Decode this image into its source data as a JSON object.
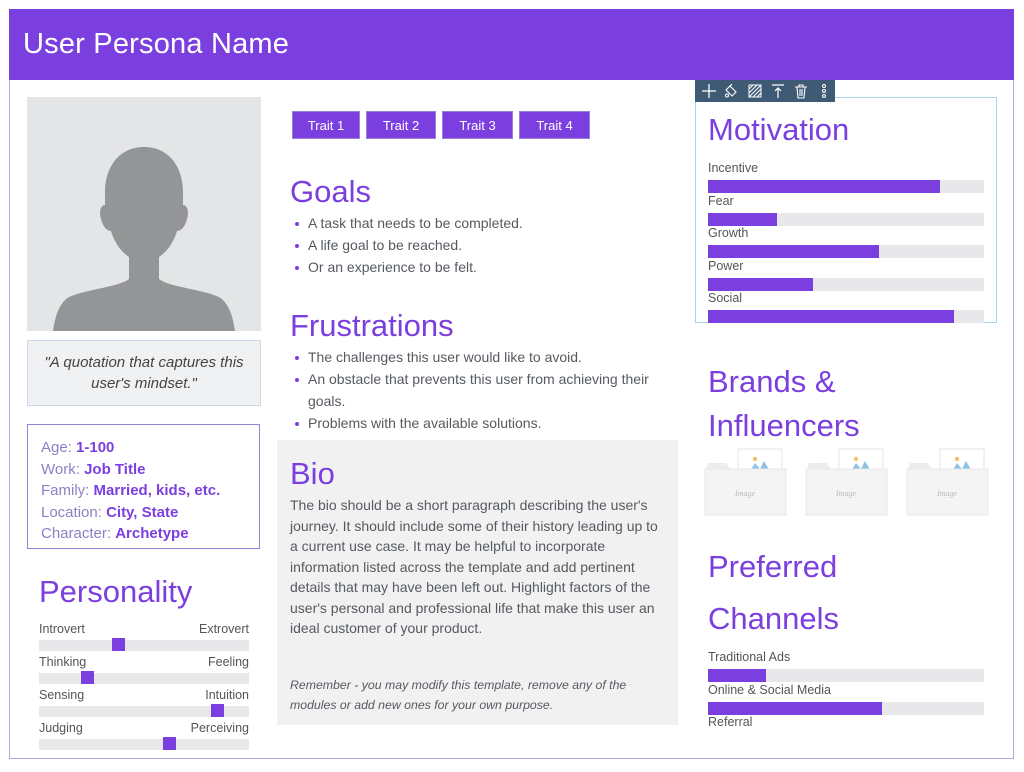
{
  "header": {
    "title": "User Persona Name"
  },
  "colors": {
    "accent": "#7b3fe0",
    "track": "#e8e8ea",
    "panel": "#f1f1f2",
    "toolbar": "#3e5a75"
  },
  "avatar": {
    "icon": "person-silhouette-icon"
  },
  "quote": "\"A quotation that captures this user's mindset.\"",
  "info": [
    {
      "label": "Age:",
      "value": "1-100"
    },
    {
      "label": "Work:",
      "value": "Job Title"
    },
    {
      "label": "Family:",
      "value": "Married, kids, etc."
    },
    {
      "label": "Location:",
      "value": "City, State"
    },
    {
      "label": "Character:",
      "value": "Archetype"
    }
  ],
  "personality": {
    "title": "Personality",
    "sliders": [
      {
        "left": "Introvert",
        "right": "Extrovert",
        "percent": 38
      },
      {
        "left": "Thinking",
        "right": "Feeling",
        "percent": 23
      },
      {
        "left": "Sensing",
        "right": "Intuition",
        "percent": 85
      },
      {
        "left": "Judging",
        "right": "Perceiving",
        "percent": 62
      }
    ]
  },
  "traits": [
    "Trait 1",
    "Trait 2",
    "Trait 3",
    "Trait 4"
  ],
  "goals": {
    "title": "Goals",
    "items": [
      "A task that needs to be completed.",
      "A life goal to be reached.",
      "Or an experience to be felt."
    ]
  },
  "frustrations": {
    "title": "Frustrations",
    "items": [
      "The challenges this user would like to avoid.",
      "An obstacle that prevents this user from achieving their goals.",
      "Problems with the available solutions."
    ]
  },
  "bio": {
    "title": "Bio",
    "body": "The bio should be a short paragraph describing the user's journey. It should include some of their history leading up to a current use case. It may be helpful to incorporate information listed across the template and add pertinent details that may have been left out. Highlight factors of the user's personal and professional life that make this user an ideal customer of your product.",
    "note": "Remember - you may modify this template, remove any of the modules or add new ones for your own purpose."
  },
  "toolbar": {
    "buttons": [
      {
        "name": "add-icon"
      },
      {
        "name": "paint-bucket-icon"
      },
      {
        "name": "pattern-fill-icon"
      },
      {
        "name": "move-to-top-icon"
      },
      {
        "name": "trash-icon"
      },
      {
        "name": "more-vertical-icon"
      }
    ]
  },
  "motivation": {
    "title": "Motivation",
    "bars": [
      {
        "label": "Incentive",
        "percent": 84
      },
      {
        "label": "Fear",
        "percent": 25
      },
      {
        "label": "Growth",
        "percent": 62
      },
      {
        "label": "Power",
        "percent": 38
      },
      {
        "label": "Social",
        "percent": 89
      }
    ]
  },
  "brands": {
    "title_line1": "Brands &",
    "title_line2": "Influencers",
    "logos": [
      {
        "placeholder": "Image"
      },
      {
        "placeholder": "Image"
      },
      {
        "placeholder": "Image"
      }
    ]
  },
  "channels": {
    "title_line1": "Preferred",
    "title_line2": "Channels",
    "bars": [
      {
        "label": "Traditional Ads",
        "percent": 21
      },
      {
        "label": "Online & Social Media",
        "percent": 63
      },
      {
        "label": "Referral",
        "percent": null
      }
    ]
  }
}
